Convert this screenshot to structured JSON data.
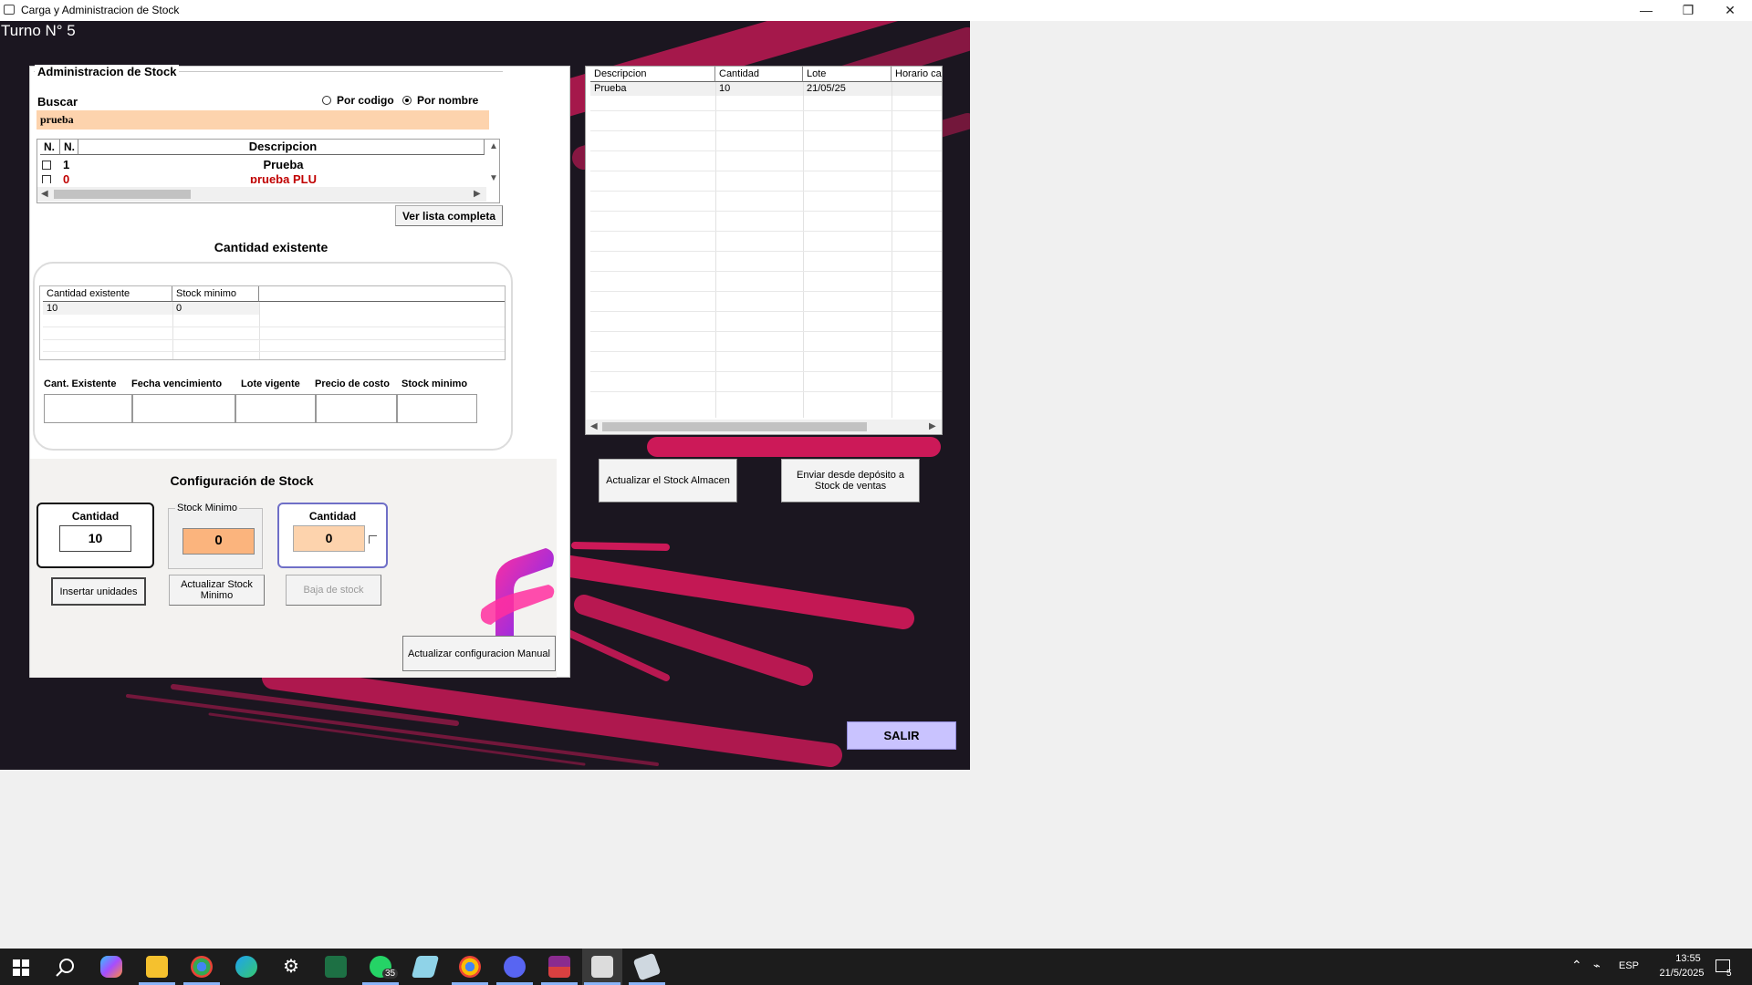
{
  "window": {
    "title": "Carga y Administracion de Stock",
    "controls": {
      "minimize": "—",
      "restore": "❐",
      "close": "✕"
    }
  },
  "turno": "Turno N° 5",
  "admin": {
    "group_title": "Administracion de Stock",
    "buscar_label": "Buscar",
    "search_value": "prueba",
    "radio_codigo": "Por codigo",
    "radio_nombre": "Por nombre",
    "selected_radio": "Por nombre",
    "results": {
      "headers": [
        "N.",
        "N.",
        "Descripcion"
      ],
      "rows": [
        {
          "n": "1",
          "descripcion": "Prueba",
          "color": "#000000"
        },
        {
          "n": "0",
          "descripcion": "prueba PLU",
          "color": "#c00000"
        }
      ]
    },
    "ver_lista_button": "Ver lista completa"
  },
  "cantidad_existente": {
    "title": "Cantidad existente",
    "headers": [
      "Cantidad existente",
      "Stock minimo"
    ],
    "rows": [
      [
        "10",
        "0"
      ]
    ],
    "fields": [
      "Cant. Existente",
      "Fecha vencimiento",
      "Lote vigente",
      "Precio de costo",
      "Stock minimo"
    ]
  },
  "config": {
    "title": "Configuración de Stock",
    "cantidad_label": "Cantidad",
    "cantidad_value": "10",
    "stock_minimo_label": "Stock Minimo",
    "stock_minimo_value": "0",
    "baja_cantidad_label": "Cantidad",
    "baja_cantidad_value": "0",
    "insertar_button": "Insertar unidades",
    "actualizar_minimo_button": "Actualizar Stock Minimo",
    "baja_button": "Baja de stock",
    "actualizar_manual_button": "Actualizar configuracion Manual"
  },
  "right_grid": {
    "headers": [
      "Descripcion",
      "Cantidad",
      "Lote",
      "Horario ca"
    ],
    "rows": [
      [
        "Prueba",
        "10",
        "21/05/25",
        ""
      ]
    ]
  },
  "actions": {
    "actualizar_almacen": "Actualizar el Stock Almacen",
    "enviar_deposito": "Enviar desde depósito a Stock de ventas",
    "salir": "SALIR"
  },
  "taskbar": {
    "lang": "ESP",
    "time": "13:55",
    "date": "21/5/2025",
    "notifications": "5",
    "whatsapp_badge": "35"
  },
  "colors": {
    "background": "#1b1620",
    "accent_pink": "#e0195e",
    "peach_input": "#fdd3ad",
    "orange_input": "#fbb47d",
    "salir_button": "#c9c3ff"
  }
}
